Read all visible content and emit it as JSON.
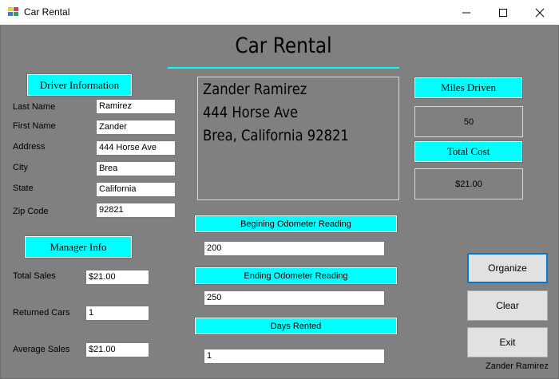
{
  "window": {
    "title": "Car Rental",
    "icon": "app-form-icon",
    "controls": [
      "minimize-icon",
      "maximize-icon",
      "close-icon"
    ]
  },
  "header": {
    "title": "Car Rental"
  },
  "driver": {
    "section_label": "Driver Information",
    "fields": [
      {
        "label": "Last Name",
        "value": "Ramirez"
      },
      {
        "label": "First Name",
        "value": "Zander"
      },
      {
        "label": "Address",
        "value": "444 Horse Ave"
      },
      {
        "label": "City",
        "value": "Brea"
      },
      {
        "label": "State",
        "value": "California"
      },
      {
        "label": "Zip Code",
        "value": "92821"
      }
    ]
  },
  "manager": {
    "section_label": "Manager Info",
    "fields": [
      {
        "label": "Total Sales",
        "value": "$21.00"
      },
      {
        "label": "Returned Cars",
        "value": "1"
      },
      {
        "label": "Average Sales",
        "value": "$21.00"
      }
    ]
  },
  "address_display": {
    "lines": [
      "Zander Ramirez",
      "444 Horse Ave",
      "Brea, California 92821"
    ]
  },
  "odometer": {
    "begin_label": "Begining Odometer Reading",
    "begin_value": "200",
    "end_label": "Ending Odometer Reading",
    "end_value": "250",
    "days_label": "Days Rented",
    "days_value": "1"
  },
  "results": {
    "miles_label": "Miles Driven",
    "miles_value": "50",
    "cost_label": "Total Cost",
    "cost_value": "$21.00"
  },
  "buttons": {
    "organize": "Organize",
    "clear": "Clear",
    "exit": "Exit"
  },
  "credit": "Zander Ramirez",
  "colors": {
    "accent": "#00ffff",
    "background": "#808080",
    "focus_border": "#0078d7"
  }
}
